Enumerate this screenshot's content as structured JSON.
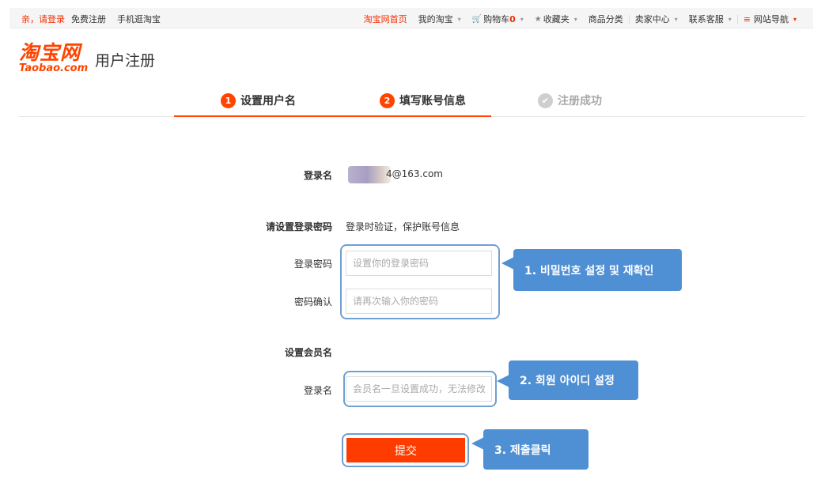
{
  "topbar": {
    "login": "亲，请登录",
    "register": "免费注册",
    "mobile": "手机逛淘宝",
    "home": "淘宝网首页",
    "my_taobao": "我的淘宝",
    "cart": "购物车",
    "cart_count": "0",
    "favorites": "收藏夹",
    "categories": "商品分类",
    "seller_center": "卖家中心",
    "customer_service": "联系客服",
    "site_nav": "网站导航"
  },
  "logo": {
    "cn": "淘宝网",
    "en": "Taobao.com"
  },
  "page_title": "用户注册",
  "steps": [
    {
      "num": "1",
      "label": "设置用户名"
    },
    {
      "num": "2",
      "label": "填写账号信息"
    },
    {
      "num": "✔",
      "label": "注册成功"
    }
  ],
  "form": {
    "login_name_label": "登录名",
    "login_name_value": "4@163.com",
    "password_section": "请设置登录密码",
    "password_hint": "登录时验证，保护账号信息",
    "password_label": "登录密码",
    "password_placeholder": "设置你的登录密码",
    "confirm_label": "密码确认",
    "confirm_placeholder": "请再次输入你的密码",
    "member_section": "设置会员名",
    "member_label": "登录名",
    "member_placeholder": "会员名一旦设置成功，无法修改",
    "submit": "提交"
  },
  "callouts": {
    "c1": "1. 비밀번호 설정 및 재확인",
    "c2": "2. 회원 아이디 설정",
    "c3": "3. 제출클릭"
  },
  "colors": {
    "accent": "#ff4400",
    "callout": "#4f8fd3",
    "highlight": "#6fa0d2"
  }
}
